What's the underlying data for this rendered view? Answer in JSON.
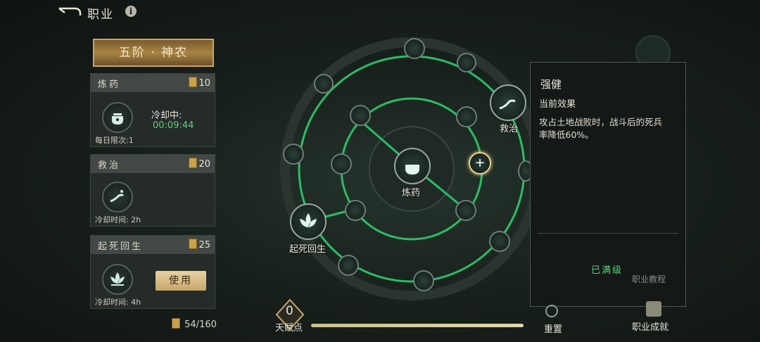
{
  "header": {
    "title": "职业",
    "info_glyph": "i"
  },
  "rank_title": "五阶 · 神农",
  "skills": [
    {
      "name": "炼药",
      "cost": "10",
      "status_label": "冷却中:",
      "timer": "00:09:44",
      "daily_limit": "每日限次:1",
      "icon": "cauldron-icon"
    },
    {
      "name": "救治",
      "cost": "20",
      "cooldown": "冷却时间: 2h",
      "icon": "healing-hand-icon"
    },
    {
      "name": "起死回生",
      "cost": "25",
      "cooldown": "冷却时间: 4h",
      "use_label": "使用",
      "icon": "lotus-icon"
    }
  ],
  "book_points": "54/160",
  "talent_tree": {
    "center_label": "炼药",
    "node_labels": {
      "heal": "救治",
      "revive": "起死回生"
    },
    "selected_icon": "plus-sparkle-icon"
  },
  "detail_panel": {
    "title": "强健",
    "effect_heading": "当前效果",
    "effect_line1": "攻占土地战败时，战斗后的死兵",
    "effect_line2": "率降低60%。",
    "status": "已满级"
  },
  "bottom": {
    "talent_points_value": "0",
    "talent_points_label": "天赋点",
    "reset_label": "重置",
    "achievement_label": "职业成就",
    "book_label": "职业教程"
  },
  "colors": {
    "accent_green": "#39d07a",
    "gold": "#c9a866",
    "timer_green": "#5fd07a"
  }
}
